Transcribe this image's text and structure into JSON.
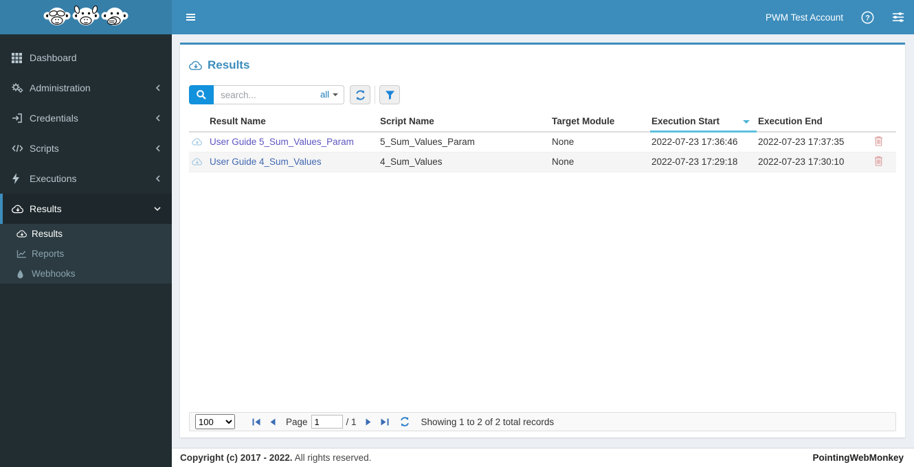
{
  "colors": {
    "navbar": "#3c8dbc",
    "logo_bg": "#367fa9",
    "sidebar_bg": "#222d32",
    "submenu_bg": "#2c3b41",
    "active_item_bg": "#1e282c",
    "accent": "#3c8dbc",
    "search_button": "#1291dc",
    "sort_indicator": "#5bc0de",
    "trash_icon": "#dd9c9c",
    "pager_icon": "#3a6db4"
  },
  "header": {
    "account_label": "PWM Test Account"
  },
  "sidebar": {
    "items": [
      {
        "label": "Dashboard",
        "icon": "grid-icon",
        "chevron": null
      },
      {
        "label": "Administration",
        "icon": "cogs-icon",
        "chevron": "left"
      },
      {
        "label": "Credentials",
        "icon": "sign-in-icon",
        "chevron": "left"
      },
      {
        "label": "Scripts",
        "icon": "code-icon",
        "chevron": "left"
      },
      {
        "label": "Executions",
        "icon": "bolt-icon",
        "chevron": "left"
      },
      {
        "label": "Results",
        "icon": "cloud-download-icon",
        "chevron": "down",
        "active": true
      }
    ],
    "submenu": [
      {
        "label": "Results",
        "icon": "cloud-download-icon",
        "active": true
      },
      {
        "label": "Reports",
        "icon": "chart-line-icon",
        "active": false
      },
      {
        "label": "Webhooks",
        "icon": "droplet-icon",
        "active": false
      }
    ]
  },
  "panel": {
    "title": "Results",
    "toolbar": {
      "search_placeholder": "search...",
      "search_scope": "all"
    }
  },
  "table": {
    "columns": [
      "Result Name",
      "Script Name",
      "Target Module",
      "Execution Start",
      "Execution End"
    ],
    "sorted_column": "Execution Start",
    "sort_direction": "desc",
    "rows": [
      {
        "result_name": "User Guide 5_Sum_Values_Param",
        "script_name": "5_Sum_Values_Param",
        "target_module": "None",
        "execution_start": "2022-07-23 17:36:46",
        "execution_end": "2022-07-23 17:37:35",
        "link_color": "#5d55c0"
      },
      {
        "result_name": "User Guide 4_Sum_Values",
        "script_name": "4_Sum_Values",
        "target_module": "None",
        "execution_start": "2022-07-23 17:29:18",
        "execution_end": "2022-07-23 17:30:10",
        "link_color": "#4168b1"
      }
    ]
  },
  "pagination": {
    "page_size": "100",
    "page_label": "Page",
    "current_page": "1",
    "total_pages_label": "/ 1",
    "summary": "Showing 1 to 2 of 2 total records"
  },
  "footer": {
    "copyright_bold": "Copyright (c) 2017 - 2022.",
    "copyright_rest": "All rights reserved.",
    "brand": "PointingWebMonkey"
  }
}
